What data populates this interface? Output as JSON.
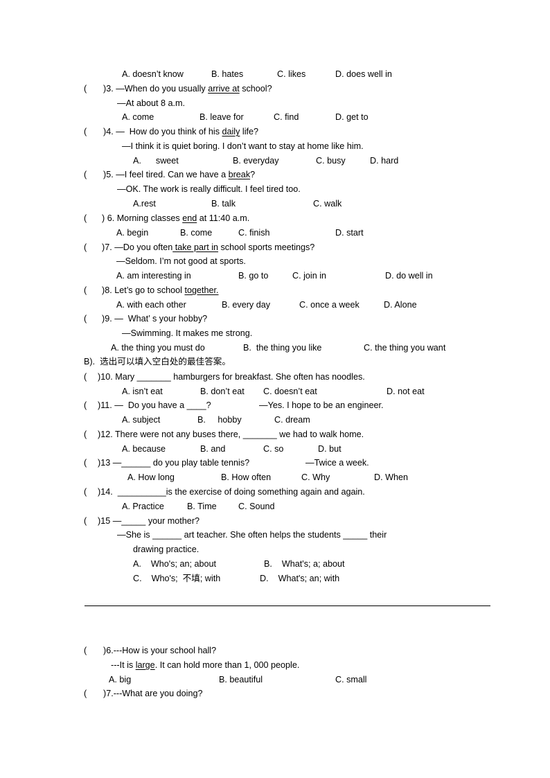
{
  "lines": [
    {
      "cols": [
        [
          {
            "t": "A. doesn’t know"
          }
        ],
        [
          {
            "t": "B. hates"
          }
        ],
        [
          {
            "t": "C. likes"
          }
        ],
        [
          {
            "t": "D. does well in"
          }
        ]
      ]
    },
    {
      "cols": [
        [
          {
            "t": "("
          }
        ],
        [
          {
            "t": ")3. —When do you usually "
          },
          {
            "t": "arrive at",
            "u": true
          },
          {
            "t": " school?"
          }
        ]
      ]
    },
    {
      "cols": [
        [
          {
            "t": "—At about 8 a.m."
          }
        ]
      ]
    },
    {
      "cols": [
        [
          {
            "t": "A. come"
          }
        ],
        [
          {
            "t": "B. leave for"
          }
        ],
        [
          {
            "t": "C. find"
          }
        ],
        [
          {
            "t": "D. get to"
          }
        ]
      ]
    },
    {
      "cols": [
        [
          {
            "t": "("
          }
        ],
        [
          {
            "t": ")4. —  How do you think of his "
          },
          {
            "t": "daily",
            "u": true
          },
          {
            "t": " life?"
          }
        ]
      ]
    },
    {
      "cols": [
        [
          {
            "t": "—I think it is quiet boring. I don’t want to stay at home like him."
          }
        ]
      ]
    },
    {
      "cols": [
        [
          {
            "t": "A.      sweet"
          }
        ],
        [
          {
            "t": "B. everyday"
          }
        ],
        [
          {
            "t": "C. busy"
          }
        ],
        [
          {
            "t": "D. hard"
          }
        ]
      ]
    },
    {
      "cols": [
        [
          {
            "t": "("
          }
        ],
        [
          {
            "t": ")5. —I feel tired. Can we have a "
          },
          {
            "t": "break",
            "u": true
          },
          {
            "t": "?"
          }
        ]
      ]
    },
    {
      "cols": [
        [
          {
            "t": "—OK. The work is really difficult. I feel tired too."
          }
        ]
      ]
    },
    {
      "cols": [
        [
          {
            "t": "A.rest"
          }
        ],
        [
          {
            "t": "B. talk"
          }
        ],
        [
          {
            "t": "C. walk"
          }
        ]
      ]
    },
    {
      "cols": [
        [
          {
            "t": "("
          }
        ],
        [
          {
            "t": ") 6. Morning classes "
          },
          {
            "t": "end",
            "u": true
          },
          {
            "t": " at 11:40 a.m."
          }
        ]
      ]
    },
    {
      "cols": [
        [
          {
            "t": "A. begin"
          }
        ],
        [
          {
            "t": "B. come"
          }
        ],
        [
          {
            "t": "C. finish"
          }
        ],
        [
          {
            "t": "D. start"
          }
        ]
      ]
    },
    {
      "cols": [
        [
          {
            "t": "("
          }
        ],
        [
          {
            "t": ")7. —Do you often"
          },
          {
            "t": " take part in",
            "u": true
          },
          {
            "t": " school sports meetings?"
          }
        ]
      ]
    },
    {
      "cols": [
        [
          {
            "t": "—Seldom. I’m not good at sports."
          }
        ]
      ]
    },
    {
      "cols": [
        [
          {
            "t": "A. am interesting in"
          }
        ],
        [
          {
            "t": "B. go to"
          }
        ],
        [
          {
            "t": "C. join in"
          }
        ],
        [
          {
            "t": "D. do well in"
          }
        ]
      ]
    },
    {
      "cols": [
        [
          {
            "t": "("
          }
        ],
        [
          {
            "t": ")8. Let’s go to school "
          },
          {
            "t": "together.",
            "u": true
          }
        ]
      ]
    },
    {
      "cols": [
        [
          {
            "t": "A. with each other"
          }
        ],
        [
          {
            "t": "B. every day"
          }
        ],
        [
          {
            "t": "C. once a week"
          }
        ],
        [
          {
            "t": "D. Alone"
          }
        ]
      ]
    },
    {
      "cols": [
        [
          {
            "t": "("
          }
        ],
        [
          {
            "t": ")9. —  What’ s your hobby?"
          }
        ]
      ]
    },
    {
      "cols": [
        [
          {
            "t": "—Swimming. It makes me strong."
          }
        ]
      ]
    },
    {
      "cols": [
        [
          {
            "t": "A. the thing you must do"
          }
        ],
        [
          {
            "t": "B.  the thing you like"
          }
        ],
        [
          {
            "t": "C. the thing you want"
          }
        ]
      ]
    },
    {
      "cols": [
        [
          {
            "t": "B).  选出可以填入空白处的最佳答案。"
          }
        ]
      ]
    },
    {
      "cols": [
        [
          {
            "t": "("
          }
        ],
        [
          {
            "t": ")10. Mary _______ hamburgers for breakfast. She often has noodles."
          }
        ]
      ]
    },
    {
      "cols": [
        [
          {
            "t": "A. isn’t eat"
          }
        ],
        [
          {
            "t": "B. don’t eat"
          }
        ],
        [
          {
            "t": "C. doesn’t eat"
          }
        ],
        [
          {
            "t": "D. not eat"
          }
        ]
      ]
    },
    {
      "cols": [
        [
          {
            "t": "("
          }
        ],
        [
          {
            "t": ")11. —  Do you have a ____?"
          }
        ],
        [
          {
            "t": "—Yes. I hope to be an engineer."
          }
        ]
      ]
    },
    {
      "cols": [
        [
          {
            "t": "A. subject"
          }
        ],
        [
          {
            "t": "B.     hobby"
          }
        ],
        [
          {
            "t": "C. dream"
          }
        ]
      ]
    },
    {
      "cols": [
        [
          {
            "t": "("
          }
        ],
        [
          {
            "t": ")12. There were not any buses there, _______ we had to walk home."
          }
        ]
      ]
    },
    {
      "cols": [
        [
          {
            "t": "A. because"
          }
        ],
        [
          {
            "t": "B. and"
          }
        ],
        [
          {
            "t": "C. so"
          }
        ],
        [
          {
            "t": "D. but"
          }
        ]
      ]
    },
    {
      "cols": [
        [
          {
            "t": "("
          }
        ],
        [
          {
            "t": ")13 —______ do you play table tennis?"
          }
        ],
        [
          {
            "t": "—Twice a week."
          }
        ]
      ]
    },
    {
      "cols": [
        [
          {
            "t": "A. How long"
          }
        ],
        [
          {
            "t": "B. How often"
          }
        ],
        [
          {
            "t": "C. Why"
          }
        ],
        [
          {
            "t": "D. When"
          }
        ]
      ]
    },
    {
      "cols": [
        [
          {
            "t": "("
          }
        ],
        [
          {
            "t": ")14.  __________is the exercise of doing something again and again."
          }
        ]
      ]
    },
    {
      "cols": [
        [
          {
            "t": "A. Practice"
          }
        ],
        [
          {
            "t": "B. Time"
          }
        ],
        [
          {
            "t": "C. Sound"
          }
        ]
      ]
    },
    {
      "cols": [
        [
          {
            "t": "("
          }
        ],
        [
          {
            "t": ")15 —_____ your mother?"
          }
        ]
      ]
    },
    {
      "cols": [
        [
          {
            "t": "—She is ______ art teacher. She often helps the students _____ their"
          }
        ]
      ]
    },
    {
      "cols": [
        [
          {
            "t": "drawing practice."
          }
        ]
      ]
    },
    {
      "cols": [
        [
          {
            "t": "A.    Who's; an; about"
          }
        ],
        [
          {
            "t": "B.    What's; a; about"
          }
        ]
      ]
    },
    {
      "cols": [
        [
          {
            "t": "C.    Who's;  不填; with"
          }
        ],
        [
          {
            "t": "D.    What's; an; with"
          }
        ]
      ]
    },
    {
      "cols": [
        [
          {
            "t": "("
          }
        ],
        [
          {
            "t": ")6.---How is your school hall?"
          }
        ]
      ]
    },
    {
      "cols": [
        [
          {
            "t": "---It is "
          },
          {
            "t": "large",
            "u": true
          },
          {
            "t": ". It can hold more than 1, 000 people."
          }
        ]
      ]
    },
    {
      "cols": [
        [
          {
            "t": "A. big"
          }
        ],
        [
          {
            "t": "B. beautiful"
          }
        ],
        [
          {
            "t": "C. small"
          }
        ]
      ]
    },
    {
      "cols": [
        [
          {
            "t": "("
          }
        ],
        [
          {
            "t": ")7.---What are you doing?"
          }
        ]
      ]
    }
  ]
}
